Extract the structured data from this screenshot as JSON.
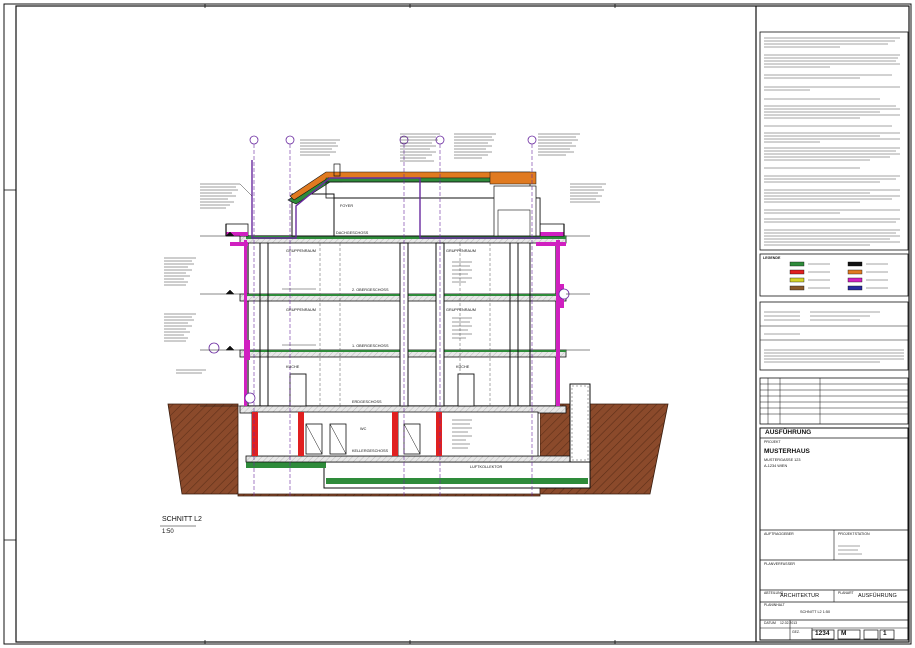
{
  "drawing": {
    "title": "SCHNITT L2",
    "scale": "1:50",
    "rooms": {
      "attic": "DACHGESCHOSS",
      "attic_room": "FOYER",
      "floor2": "2. OBERGESCHOSS",
      "floor1": "1. OBERGESCHOSS",
      "ground": "ERDGESCHOSS",
      "basement": "KELLERGESCHOSS",
      "office_a": "GRUPPENRAUM",
      "office_b": "GRUPPENRAUM",
      "office_c": "GRUPPENRAUM",
      "office_d": "GRUPPENRAUM",
      "kitchen_a": "KÜCHE",
      "kitchen_b": "KÜCHE",
      "wc": "WC",
      "shaft": "LUFTKOLLEKTOR"
    }
  },
  "legend": {
    "title": "LEGENDE",
    "items": [
      {
        "color": "#2e8b3a"
      },
      {
        "color": "#111111"
      },
      {
        "color": "#e02020"
      },
      {
        "color": "#e07a20"
      },
      {
        "color": "#d4d42a"
      },
      {
        "color": "#d020c0"
      },
      {
        "color": "#8a5a2b"
      },
      {
        "color": "#2a2aa0"
      }
    ]
  },
  "title_block": {
    "status_header": "AUSFÜHRUNG",
    "project_label": "PROJEKT",
    "project_name": "MUSTERHAUS",
    "address_line1": "MUSTERGASSE 123",
    "address_line2": "A-1234 WIEN",
    "client_label": "AUFTRAGGEBER",
    "planner_label": "PROJEKTSTATION",
    "planner_label2": "PLANVERFASSER",
    "discipline_label": "ABTEILUNG",
    "discipline_value": "ARCHITEKTUR",
    "phase_label": "PLANART",
    "phase_value": "AUSFÜHRUNG",
    "content_label": "PLANINHALT",
    "content_value": "SCHNITT L2   1:50",
    "date_label": "DATUM",
    "date_value": "12.02.2013",
    "drawn_label": "GEZ.",
    "plan_no": "1234",
    "index_value": "M",
    "sheet_value": "1"
  },
  "colors": {
    "line": "#111111",
    "soil": "#8b4a2b",
    "insulation_green": "#2e8b3a",
    "membrane_magenta": "#d020c0",
    "fire_red": "#e02020",
    "roof_orange": "#e07a20",
    "section_purple": "#6a2aa0"
  }
}
